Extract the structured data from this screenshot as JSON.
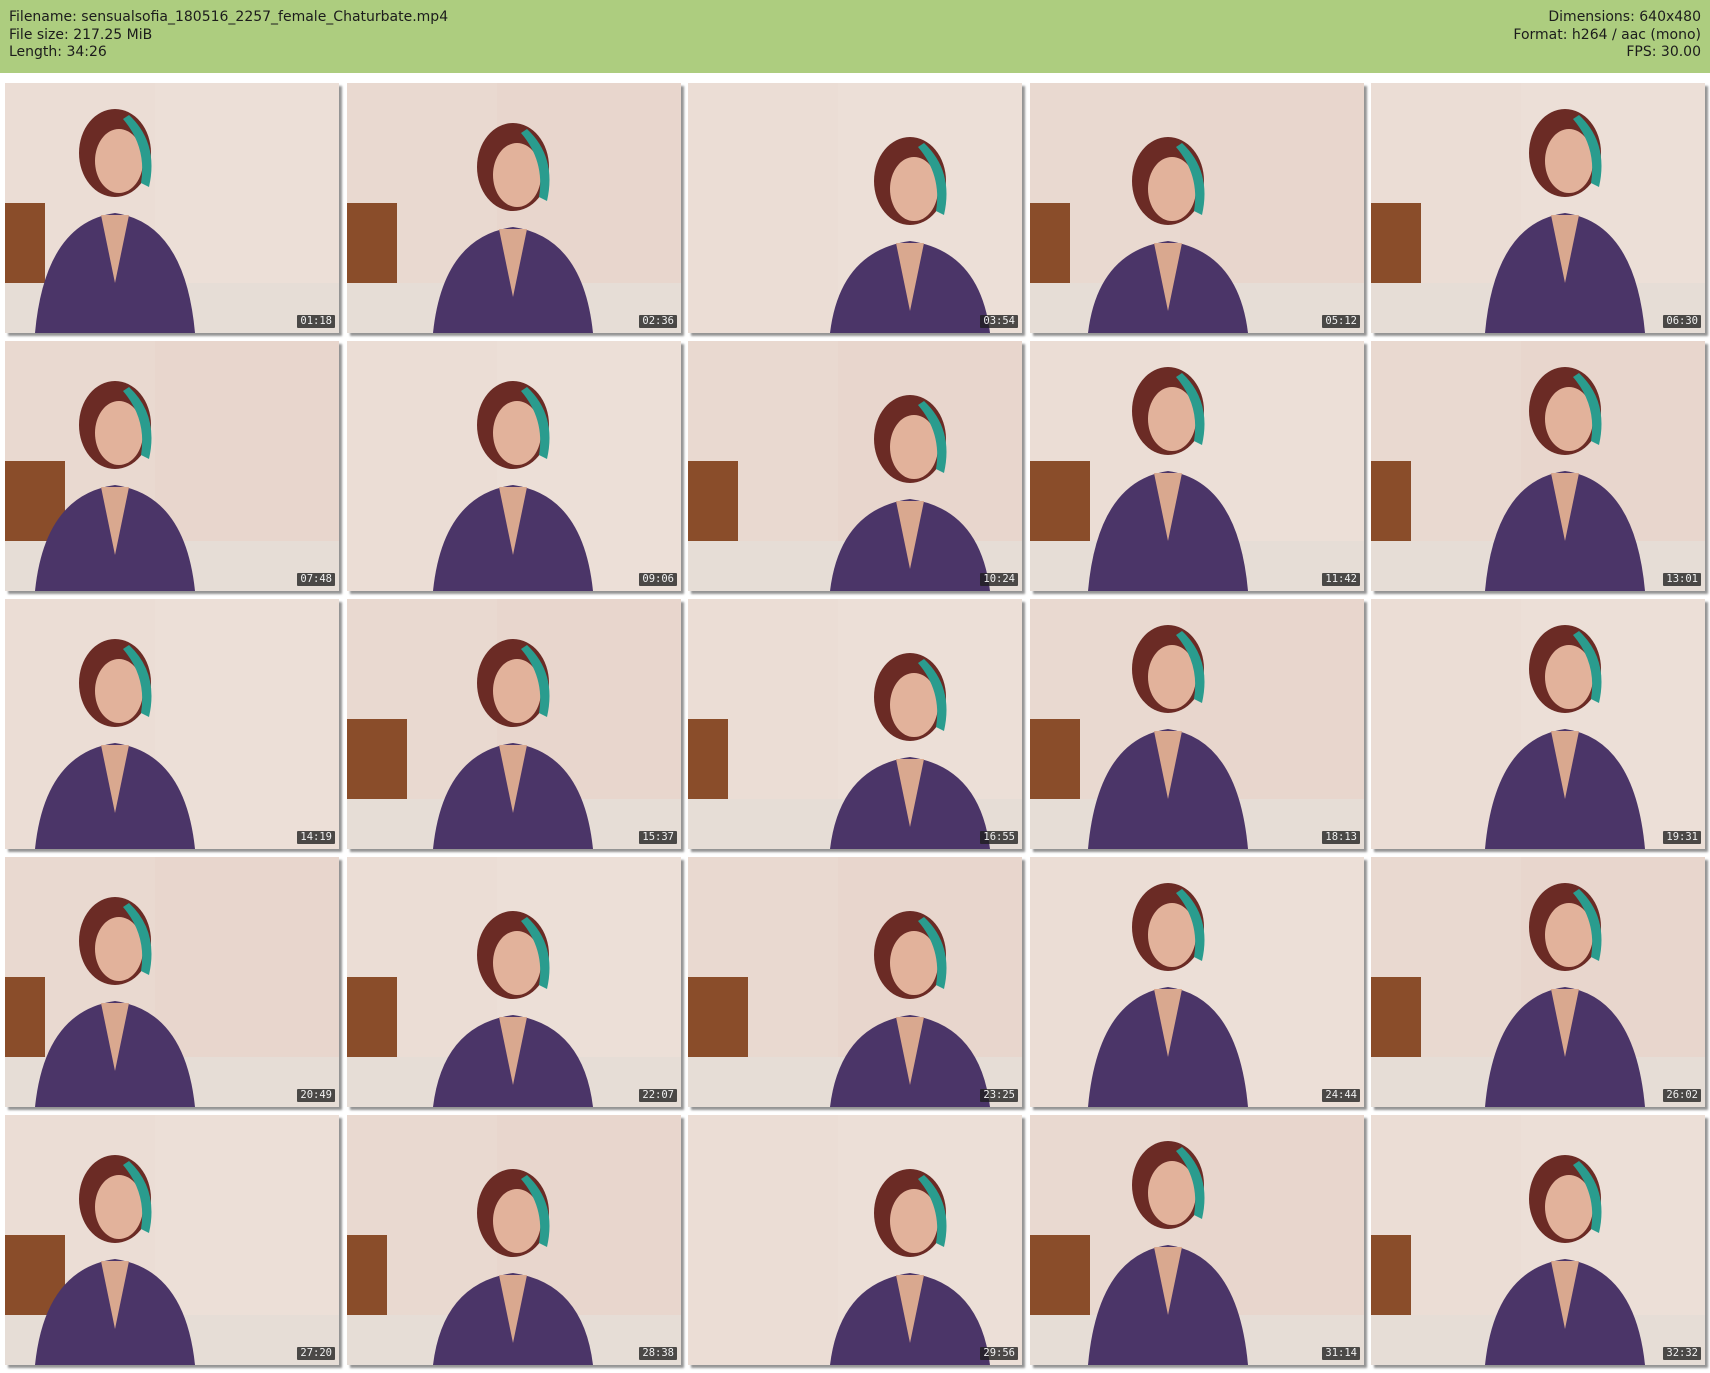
{
  "header": {
    "filename": "Filename: sensualsofia_180516_2257_female_Chaturbate.mp4",
    "file_size": "File size: 217.25 MiB",
    "length": "Length: 34:26",
    "dimensions": "Dimensions: 640x480",
    "format": "Format: h264 / aac (mono)",
    "fps": "FPS: 30.00"
  },
  "colors": {
    "header_background": "#adcd7f",
    "dress": "#4b3568",
    "hair": "#6b2b25",
    "hair_streak": "#2a9c8e",
    "wall": "#eadbd3",
    "bed_frame": "#8a4d2a"
  },
  "thumbnails": [
    {
      "timestamp": "01:18"
    },
    {
      "timestamp": "02:36"
    },
    {
      "timestamp": "03:54"
    },
    {
      "timestamp": "05:12"
    },
    {
      "timestamp": "06:30"
    },
    {
      "timestamp": "07:48"
    },
    {
      "timestamp": "09:06"
    },
    {
      "timestamp": "10:24"
    },
    {
      "timestamp": "11:42"
    },
    {
      "timestamp": "13:01"
    },
    {
      "timestamp": "14:19"
    },
    {
      "timestamp": "15:37"
    },
    {
      "timestamp": "16:55"
    },
    {
      "timestamp": "18:13"
    },
    {
      "timestamp": "19:31"
    },
    {
      "timestamp": "20:49"
    },
    {
      "timestamp": "22:07"
    },
    {
      "timestamp": "23:25"
    },
    {
      "timestamp": "24:44"
    },
    {
      "timestamp": "26:02"
    },
    {
      "timestamp": "27:20"
    },
    {
      "timestamp": "28:38"
    },
    {
      "timestamp": "29:56"
    },
    {
      "timestamp": "31:14"
    },
    {
      "timestamp": "32:32"
    }
  ]
}
